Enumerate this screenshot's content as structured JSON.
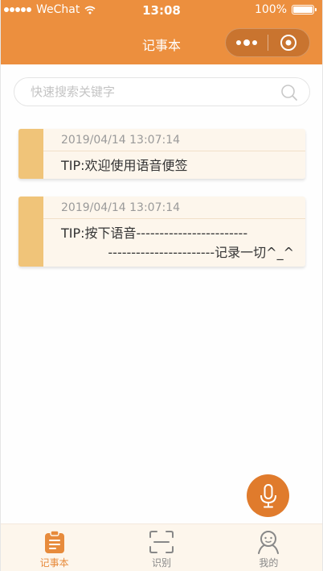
{
  "status_bar": {
    "carrier": "WeChat",
    "time": "13:08",
    "battery": "100%"
  },
  "nav": {
    "title": "记事本"
  },
  "search": {
    "placeholder": "快速搜索关键字",
    "value": ""
  },
  "notes": [
    {
      "date": "2019/04/14 13:07:14",
      "text_line1": "TIP:欢迎使用语音便签",
      "text_line2": ""
    },
    {
      "date": "2019/04/14 13:07:14",
      "text_line1": "TIP:按下语音------------------------",
      "text_line2": "-----------------------记录一切^_^"
    }
  ],
  "tabs": [
    {
      "label": "记事本",
      "active": true
    },
    {
      "label": "识别",
      "active": false
    },
    {
      "label": "我的",
      "active": false
    }
  ],
  "colors": {
    "accent": "#ec8f3e",
    "stripe": "#f0c479",
    "card_bg": "#fdf6ec",
    "mic": "#e07b2c"
  },
  "icons": {
    "wifi": "wifi-icon",
    "battery": "battery-icon",
    "more": "more-dots-icon",
    "close": "target-circle-icon",
    "search": "search-icon",
    "mic": "microphone-icon",
    "tab_notes": "clipboard-icon",
    "tab_recognize": "scan-icon",
    "tab_mine": "person-icon"
  }
}
